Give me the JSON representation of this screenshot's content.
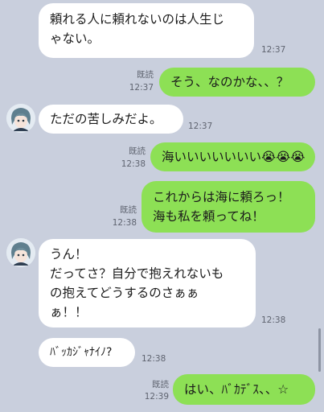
{
  "messages": [
    {
      "side": "in",
      "lines": [
        "頼れる人に頼れないのは人生じ",
        "ゃない。"
      ],
      "time": "12:37"
    },
    {
      "side": "out",
      "lines": [
        "そう、なのかな、、？"
      ],
      "read": "既読",
      "time": "12:37"
    },
    {
      "side": "in",
      "lines": [
        "ただの苦しみだよ。"
      ],
      "time": "12:37",
      "avatar": true
    },
    {
      "side": "out",
      "lines": [
        "海いいいいいいい😭😭😭"
      ],
      "read": "既読",
      "time": "12:38"
    },
    {
      "side": "out",
      "lines": [
        "これからは海に頼ろっ！",
        "海も私を頼ってね！"
      ],
      "read": "既読",
      "time": "12:38"
    },
    {
      "side": "in",
      "lines": [
        "うん！",
        "だってさ？自分で抱えれないも",
        "の抱えてどうするのさぁぁ",
        "ぁ！！"
      ],
      "time": "12:38",
      "avatar": true
    },
    {
      "side": "in",
      "lines": [
        "ﾊﾞｯｶｼﾞｬﾅｲﾉ?"
      ],
      "time": "12:38"
    },
    {
      "side": "out",
      "lines": [
        "はい、ﾊﾞｶﾃﾞｽ、、☆"
      ],
      "read": "既読",
      "time": "12:39"
    }
  ],
  "colors": {
    "background": "#c9cfdd",
    "incoming": "#ffffff",
    "outgoing": "#8de055"
  }
}
